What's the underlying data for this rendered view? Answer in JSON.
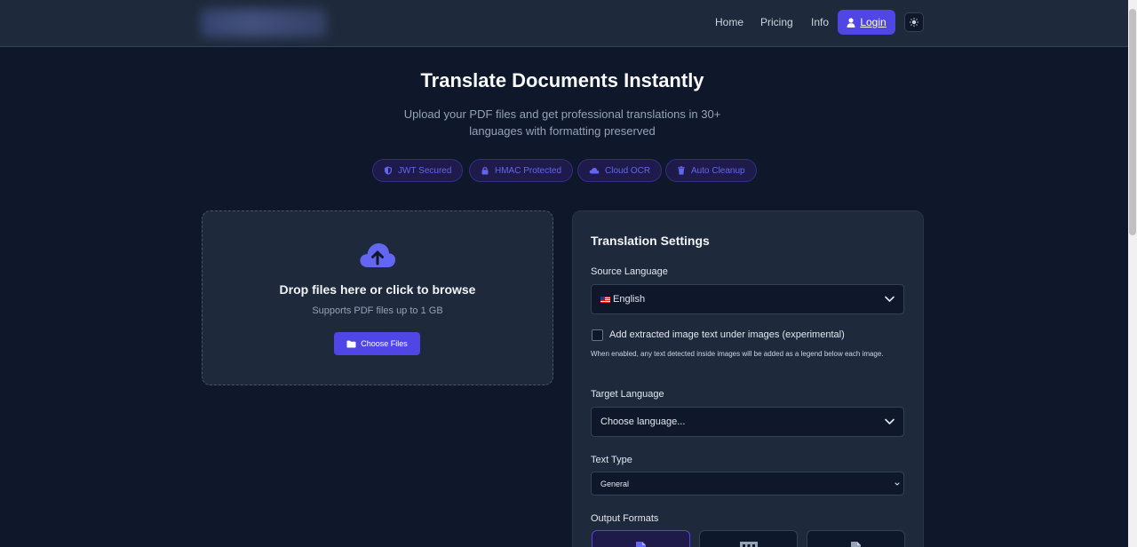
{
  "header": {
    "nav": {
      "home": "Home",
      "pricing": "Pricing",
      "info": "Info"
    },
    "login_label": "Login",
    "theme_toggle_icon": "sun-icon"
  },
  "hero": {
    "title": "Translate Documents Instantly",
    "subtitle": "Upload your PDF files and get professional translations in 30+ languages with formatting preserved"
  },
  "badges": [
    {
      "label": "JWT Secured",
      "icon": "shield-icon"
    },
    {
      "label": "HMAC Protected",
      "icon": "lock-icon"
    },
    {
      "label": "Cloud OCR",
      "icon": "cloud-icon"
    },
    {
      "label": "Auto Cleanup",
      "icon": "trash-icon"
    }
  ],
  "dropzone": {
    "title": "Drop files here or click to browse",
    "subtitle": "Supports PDF files up to 1 GB",
    "button_label": "Choose Files"
  },
  "settings": {
    "title": "Translation Settings",
    "source_language_label": "Source Language",
    "source_language_value": "English",
    "image_text_label": "Add extracted image text under images (experimental)",
    "image_text_help": "When enabled, any text detected inside images will be added as a legend below each image.",
    "image_text_checked": false,
    "target_language_label": "Target Language",
    "target_language_value": "Choose language...",
    "text_type_label": "Text Type",
    "text_type_value": "General",
    "output_formats_label": "Output Formats"
  },
  "colors": {
    "accent": "#4f46e5",
    "background": "#0f172a",
    "surface": "#1e293b"
  }
}
